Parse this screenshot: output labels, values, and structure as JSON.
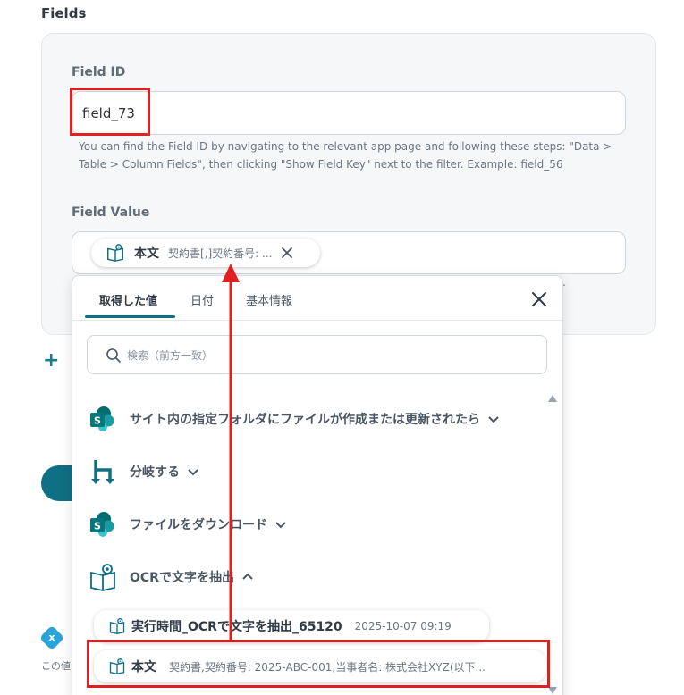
{
  "section_title": "Fields",
  "field_id": {
    "label": "Field ID",
    "value": "field_73",
    "help": "You can find the Field ID by navigating to the relevant app page and following these steps: \"Data > Table > Column Fields\", then clicking \"Show Field Key\" next to the filter. Example: field_56"
  },
  "field_value": {
    "label": "Field Value",
    "chip_title": "本文",
    "chip_sub": "契約書[,]契約番号: ...",
    "trailing": "."
  },
  "left_snippet": "この値",
  "dropdown": {
    "tabs": [
      "取得した値",
      "日付",
      "基本情報"
    ],
    "active_tab": 0,
    "search_placeholder": "検索（前方一致）",
    "items": [
      {
        "label": "サイト内の指定フォルダにファイルが作成または更新されたら",
        "icon": "sharepoint-icon",
        "expanded": false
      },
      {
        "label": "分岐する",
        "icon": "branch-icon",
        "expanded": false
      },
      {
        "label": "ファイルをダウンロード",
        "icon": "sharepoint-icon",
        "expanded": false
      },
      {
        "label": "OCRで文字を抽出",
        "icon": "ocr-book-icon",
        "expanded": true
      }
    ],
    "sub_items": [
      {
        "title": "実行時間_OCRで文字を抽出_65120",
        "sub": "2025-10-07 09:19"
      },
      {
        "title": "本文",
        "sub": "契約書,契約番号: 2025-ABC-001,当事者名: 株式会社XYZ(以下..."
      }
    ]
  },
  "colors": {
    "accent": "#0f6f85",
    "highlight": "#e02020"
  }
}
